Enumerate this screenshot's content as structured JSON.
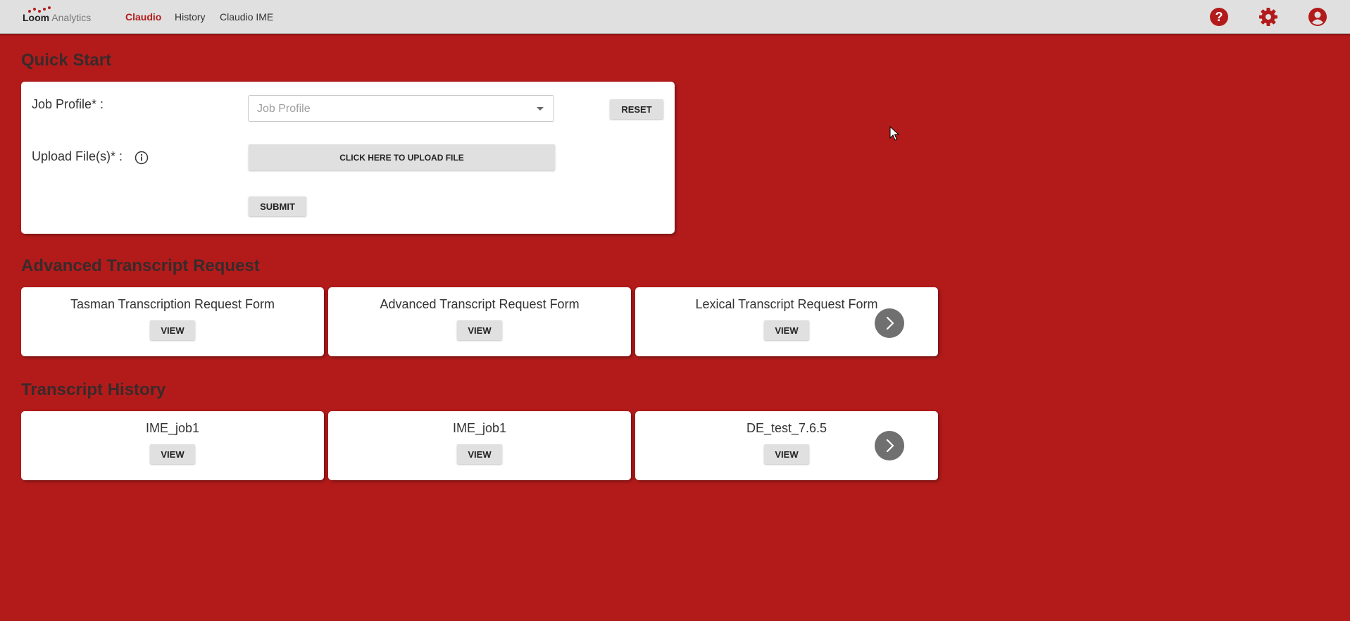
{
  "header": {
    "logo": {
      "bold": "Loom",
      "light": "Analytics"
    },
    "nav": [
      {
        "label": "Claudio",
        "active": true
      },
      {
        "label": "History",
        "active": false
      },
      {
        "label": "Claudio IME",
        "active": false
      }
    ],
    "icons": [
      "help-icon",
      "gear-icon",
      "account-icon"
    ],
    "accent_color": "#b31b1b"
  },
  "quick_start": {
    "title": "Quick Start",
    "job_profile_label": "Job Profile* :",
    "job_profile_placeholder": "Job Profile",
    "job_profile_value": "",
    "reset_label": "RESET",
    "upload_label": "Upload File(s)* :",
    "upload_button_label": "CLICK HERE TO UPLOAD FILE",
    "submit_label": "SUBMIT"
  },
  "advanced": {
    "title": "Advanced Transcript Request",
    "cards": [
      {
        "title": "Tasman Transcription Request Form",
        "button": "VIEW"
      },
      {
        "title": "Advanced Transcript Request Form",
        "button": "VIEW"
      },
      {
        "title": "Lexical Transcript Request Form",
        "button": "VIEW"
      }
    ]
  },
  "history": {
    "title": "Transcript History",
    "cards": [
      {
        "title": "IME_job1",
        "button": "VIEW"
      },
      {
        "title": "IME_job1",
        "button": "VIEW"
      },
      {
        "title": "DE_test_7.6.5",
        "button": "VIEW"
      }
    ]
  },
  "colors": {
    "background": "#b31b1b",
    "topbar": "#e0e0e0",
    "button": "#e0e0e0",
    "arrow_button": "#707070"
  }
}
